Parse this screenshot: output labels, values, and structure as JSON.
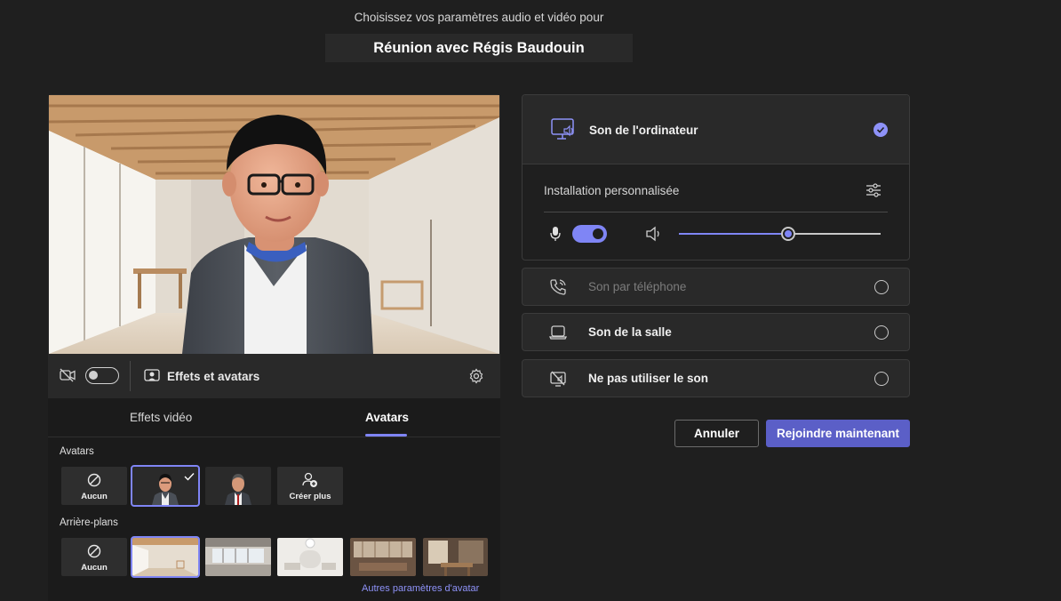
{
  "header": {
    "subtitle": "Choisissez vos paramètres audio et vidéo pour",
    "meeting_title": "Réunion avec Régis Baudouin"
  },
  "video_bar": {
    "effects_label": "Effets et avatars",
    "camera_on": false
  },
  "effects_panel": {
    "tabs": [
      {
        "label": "Effets vidéo",
        "active": false
      },
      {
        "label": "Avatars",
        "active": true
      }
    ],
    "avatars_label": "Avatars",
    "avatars": [
      {
        "label": "Aucun",
        "icon": "none-icon"
      },
      {
        "label": "",
        "icon": "avatar-young-man",
        "selected": true
      },
      {
        "label": "",
        "icon": "avatar-older-man"
      },
      {
        "label": "Créer plus",
        "icon": "add-person-icon"
      }
    ],
    "backgrounds_label": "Arrière-plans",
    "backgrounds": [
      {
        "label": "Aucun",
        "icon": "none-icon"
      },
      {
        "label": "",
        "icon": "bg-loft-room",
        "selected": true
      },
      {
        "label": "",
        "icon": "bg-open-office"
      },
      {
        "label": "",
        "icon": "bg-white-lounge"
      },
      {
        "label": "",
        "icon": "bg-wood-lounge"
      },
      {
        "label": "",
        "icon": "bg-dining-room"
      }
    ],
    "more_link": "Autres paramètres d'avatar"
  },
  "audio": {
    "computer_audio": {
      "label": "Son de l'ordinateur",
      "icon": "monitor-speaker-icon",
      "selected": true
    },
    "custom_setup": "Installation personnalisée",
    "mic_on": true,
    "speaker_volume_percent": 54,
    "options": [
      {
        "label": "Son par téléphone",
        "icon": "phone-icon",
        "disabled": true
      },
      {
        "label": "Son de la salle",
        "icon": "room-device-icon",
        "disabled": false
      },
      {
        "label": "Ne pas utiliser le son",
        "icon": "no-audio-icon",
        "disabled": false
      }
    ]
  },
  "actions": {
    "cancel": "Annuler",
    "join": "Rejoindre maintenant"
  },
  "colors": {
    "accent": "#7f85f5",
    "primary_button": "#5b5fc7",
    "background": "#1f1f1f"
  }
}
